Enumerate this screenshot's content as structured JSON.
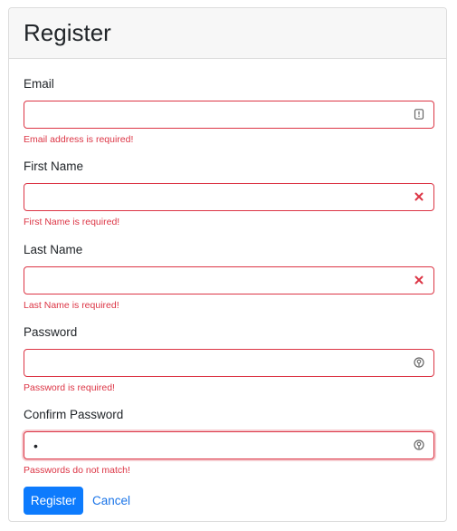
{
  "form": {
    "title": "Register",
    "fields": [
      {
        "label": "Email",
        "value": "",
        "error": "Email address is required!",
        "icon": "info-card-icon"
      },
      {
        "label": "First Name",
        "value": "",
        "error": "First Name is required!",
        "icon": "error-x-icon"
      },
      {
        "label": "Last Name",
        "value": "",
        "error": "Last Name is required!",
        "icon": "error-x-icon"
      },
      {
        "label": "Password",
        "value": "",
        "error": "Password is required!",
        "icon": "password-manager-icon"
      },
      {
        "label": "Confirm Password",
        "value": "•",
        "error": "Passwords do not match!",
        "icon": "password-manager-icon"
      }
    ],
    "submit_label": "Register",
    "cancel_label": "Cancel"
  },
  "colors": {
    "error": "#dc3545",
    "primary": "#0d7bfd",
    "link": "#1a74e8"
  }
}
